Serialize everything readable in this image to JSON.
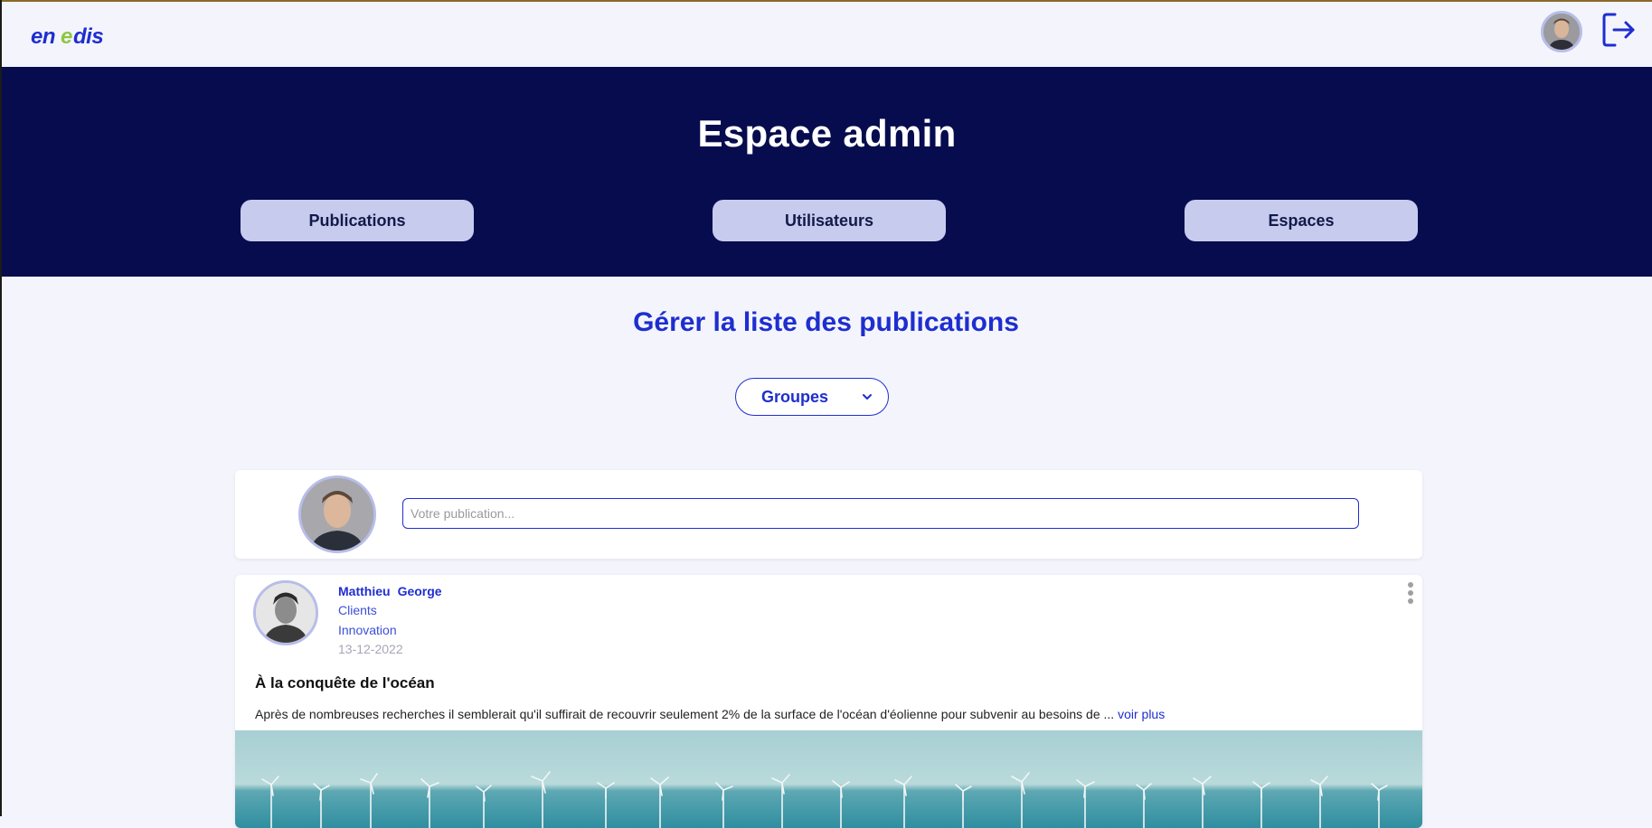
{
  "brand": {
    "logo_text": "enedis",
    "logo_color": "#1e2ed0",
    "logo_accent": "#8dc63f"
  },
  "header": {
    "avatar_icon": "user-avatar",
    "logout_icon": "logout-icon"
  },
  "hero": {
    "title": "Espace admin",
    "tabs": [
      {
        "label": "Publications"
      },
      {
        "label": "Utilisateurs"
      },
      {
        "label": "Espaces"
      }
    ]
  },
  "main": {
    "title": "Gérer la liste des publications",
    "filter": {
      "selected": "Groupes",
      "icon": "chevron-down-icon"
    }
  },
  "composer": {
    "placeholder": "Votre publication..."
  },
  "posts": [
    {
      "author_first": "Matthieu",
      "author_last": "George",
      "group": "Clients",
      "space": "Innovation",
      "date": "13-12-2022",
      "title": "À la conquête de l'océan",
      "excerpt": "Après de nombreuses recherches il semblerait qu'il suffirait de recouvrir seulement 2% de la surface de l'océan d'éolienne pour subvenir au besoins de ...",
      "more_label": "voir plus",
      "image_subject": "offshore wind farm"
    }
  ],
  "colors": {
    "primary": "#1e2ed0",
    "hero_bg": "#070c4e",
    "tab_bg": "#c7cbee",
    "page_bg": "#f4f5fc"
  }
}
